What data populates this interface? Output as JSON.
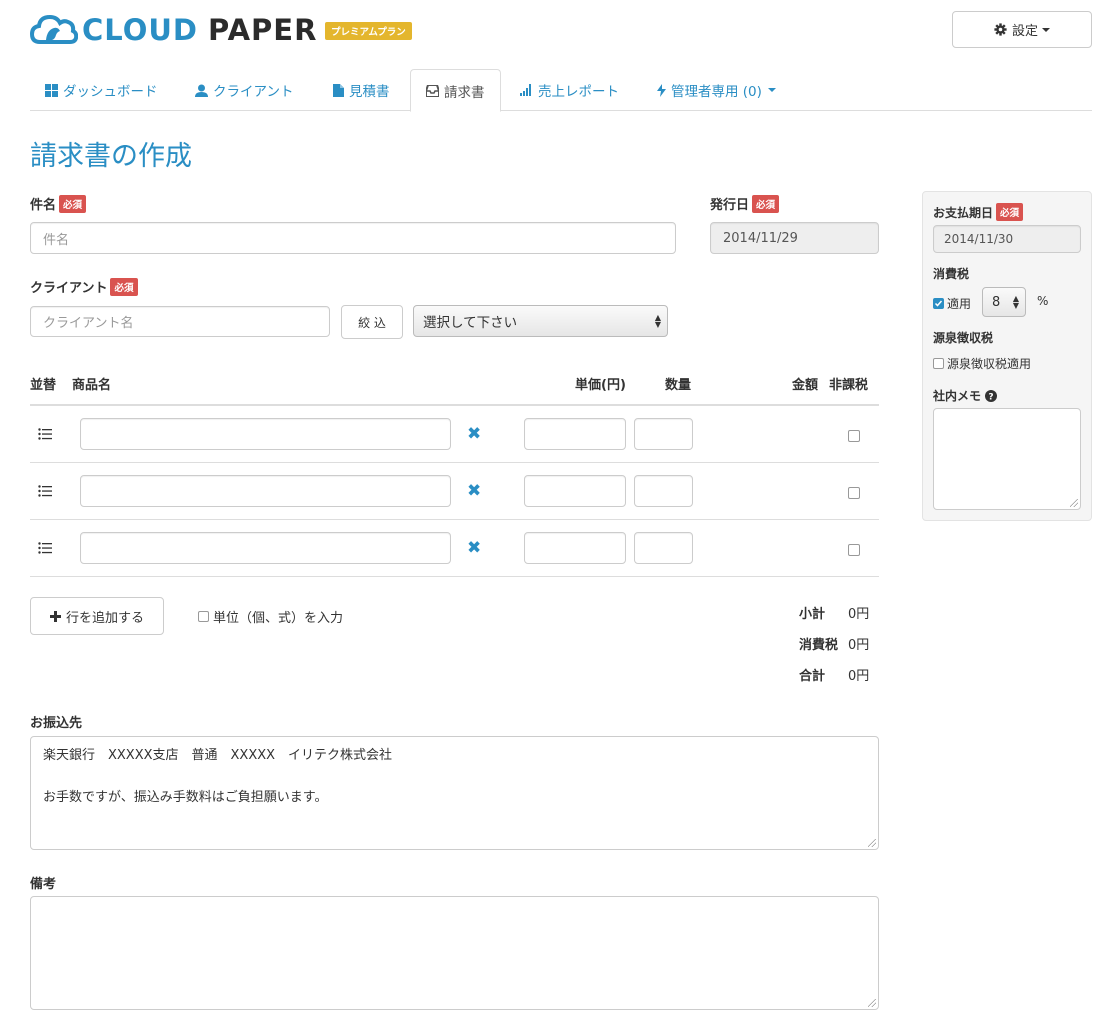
{
  "header": {
    "logo_part1": "CLOUD",
    "logo_part2": "PAPER",
    "plan_badge": "プレミアムプラン",
    "settings_label": "設定"
  },
  "tabs": [
    {
      "label": "ダッシュボード",
      "icon": "dashboard-icon"
    },
    {
      "label": "クライアント",
      "icon": "user-icon"
    },
    {
      "label": "見積書",
      "icon": "file-icon"
    },
    {
      "label": "請求書",
      "icon": "inbox-icon"
    },
    {
      "label": "売上レポート",
      "icon": "signal-icon"
    },
    {
      "label": "管理者専用 (0)",
      "icon": "bolt-icon"
    }
  ],
  "page_title": "請求書の作成",
  "form": {
    "subject_label": "件名",
    "required_badge": "必須",
    "subject_placeholder": "件名",
    "issue_date_label": "発行日",
    "issue_date_value": "2014/11/29",
    "client_label": "クライアント",
    "client_placeholder": "クライアント名",
    "filter_button": "絞 込",
    "client_select": "選択して下さい"
  },
  "items_table": {
    "col_sort": "並替",
    "col_product": "商品名",
    "col_unit_price": "単価(円)",
    "col_quantity": "数量",
    "col_amount": "金額",
    "col_tax_exempt": "非課税"
  },
  "actions": {
    "add_row": "行を追加する",
    "unit_input_label": "単位（個、式）を入力"
  },
  "totals": {
    "subtotal_label": "小計",
    "subtotal_value": "0円",
    "tax_label": "消費税",
    "tax_value": "0円",
    "total_label": "合計",
    "total_value": "0円"
  },
  "bank": {
    "label": "お振込先",
    "line1": "楽天銀行　XXXXX支店　普通　XXXXX　イリテク株式会社",
    "line2": "お手数ですが、振込み手数料はご負担願います。"
  },
  "notes": {
    "label": "備考"
  },
  "sidebar": {
    "due_date_label": "お支払期日",
    "due_date_value": "2014/11/30",
    "tax_label": "消費税",
    "tax_apply_label": "適用",
    "tax_rate": "8",
    "percent": "%",
    "withholding_label": "源泉徴収税",
    "withholding_apply_label": "源泉徴収税適用",
    "memo_label": "社内メモ"
  },
  "colors": {
    "brand": "#2a8ec4",
    "required": "#d9534f",
    "plan_badge": "#e4b62d"
  }
}
